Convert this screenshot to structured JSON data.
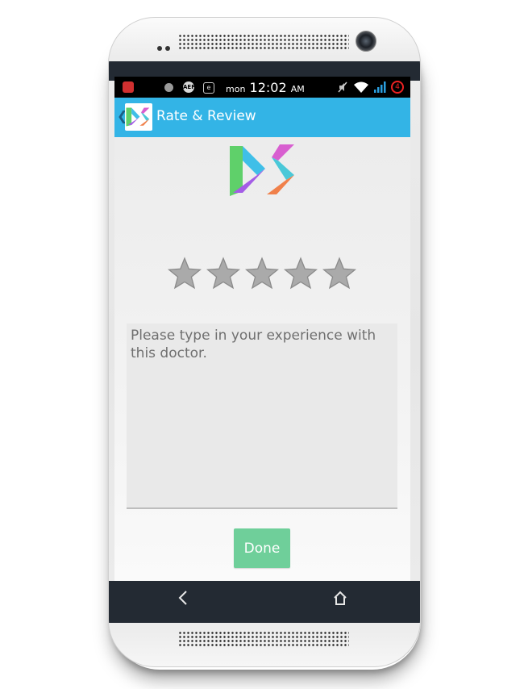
{
  "status_bar": {
    "day": "mon",
    "time": "12:02",
    "ampm": "AM",
    "badge_text": "AEP",
    "e_icon": "e",
    "battery_badge": "4",
    "icons": [
      "notification-icon",
      "circle-icon",
      "aep-icon",
      "e-icon",
      "mute-icon",
      "wifi-icon",
      "signal-icon",
      "battery-icon"
    ]
  },
  "action_bar": {
    "title": "Rate & Review",
    "back_glyph": "❮",
    "color": "#33b4e6"
  },
  "rating": {
    "max_stars": 5,
    "value": 0,
    "empty_color": "#aaaaaa"
  },
  "review": {
    "value": "",
    "placeholder": "Please type in your experience with this doctor."
  },
  "done_button": {
    "label": "Done",
    "color": "#6fcf9a"
  },
  "nav_bar": {
    "icons": [
      "back-icon",
      "home-icon"
    ]
  }
}
